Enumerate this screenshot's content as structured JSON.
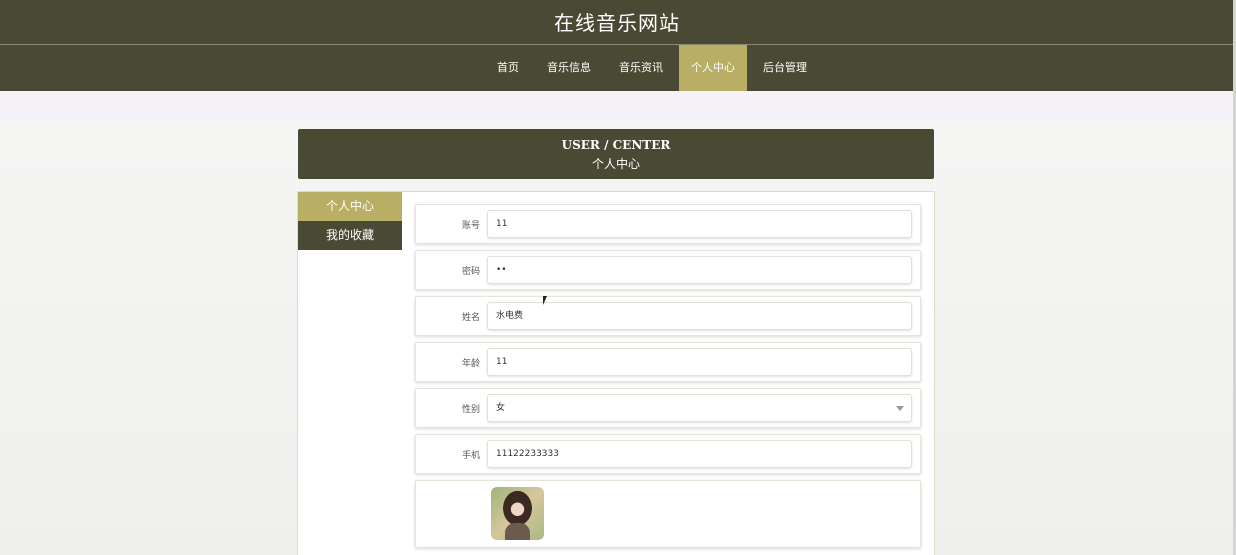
{
  "site": {
    "title": "在线音乐网站"
  },
  "nav": [
    {
      "label": "首页",
      "active": false
    },
    {
      "label": "音乐信息",
      "active": false
    },
    {
      "label": "音乐资讯",
      "active": false
    },
    {
      "label": "个人中心",
      "active": true
    },
    {
      "label": "后台管理",
      "active": false
    }
  ],
  "banner": {
    "en": "USER / CENTER",
    "cn": "个人中心"
  },
  "side_menu": [
    {
      "label": "个人中心",
      "active": true
    },
    {
      "label": "我的收藏",
      "active": false
    }
  ],
  "form": {
    "account": {
      "label": "账号",
      "value": "11"
    },
    "password": {
      "label": "密码",
      "value": "••"
    },
    "name": {
      "label": "姓名",
      "value": "水电费"
    },
    "age": {
      "label": "年龄",
      "value": "11"
    },
    "gender": {
      "label": "性别",
      "value": "女"
    },
    "phone": {
      "label": "手机",
      "value": "11122233333"
    }
  },
  "colors": {
    "primary": "#4a4a34",
    "accent": "#b8ae64"
  }
}
